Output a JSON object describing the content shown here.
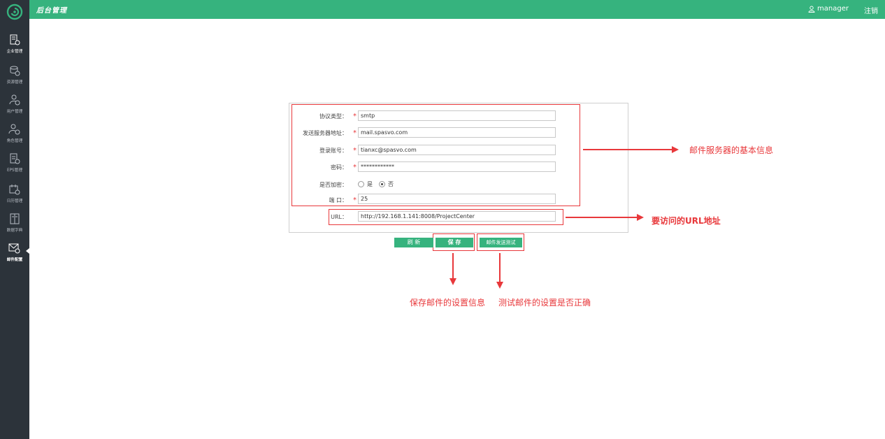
{
  "header": {
    "title": "后台管理",
    "username": "manager",
    "logout_label": "注销"
  },
  "sidebar": {
    "items": [
      {
        "label": "企业管理",
        "icon": "enterprise-icon"
      },
      {
        "label": "资源管理",
        "icon": "resource-icon"
      },
      {
        "label": "用户管理",
        "icon": "user-icon"
      },
      {
        "label": "角色管理",
        "icon": "role-icon"
      },
      {
        "label": "EPS管理",
        "icon": "eps-icon"
      },
      {
        "label": "日历管理",
        "icon": "calendar-icon"
      },
      {
        "label": "数据字典",
        "icon": "dictionary-icon"
      },
      {
        "label": "邮件配置",
        "icon": "mail-config-icon",
        "active": true
      }
    ]
  },
  "form": {
    "protocol": {
      "label": "协议类型：",
      "value": "smtp"
    },
    "server": {
      "label": "发送服务器地址：",
      "value": "mail.spasvo.com"
    },
    "account": {
      "label": "登录账号：",
      "value": "tianxc@spasvo.com"
    },
    "password": {
      "label": "密码：",
      "value": "************"
    },
    "encrypt": {
      "label": "是否加密：",
      "options": [
        "是",
        "否"
      ],
      "selected": "否"
    },
    "port": {
      "label": "端  口：",
      "value": "25"
    },
    "url": {
      "label": "URL：",
      "value": "http://192.168.1.141:8008/ProjectCenter"
    },
    "required_mark": "*"
  },
  "buttons": {
    "refresh": "刷    新",
    "save": "保    存",
    "test": "邮件发送测试"
  },
  "annotations": {
    "server_info": "邮件服务器的基本信息",
    "url_info": "要访问的URL地址",
    "save_info": "保存邮件的设置信息",
    "test_info": "测试邮件的设置是否正确"
  },
  "colors": {
    "accent": "#36b37e",
    "sidebar": "#2c333a",
    "annotation": "#e8383b"
  }
}
